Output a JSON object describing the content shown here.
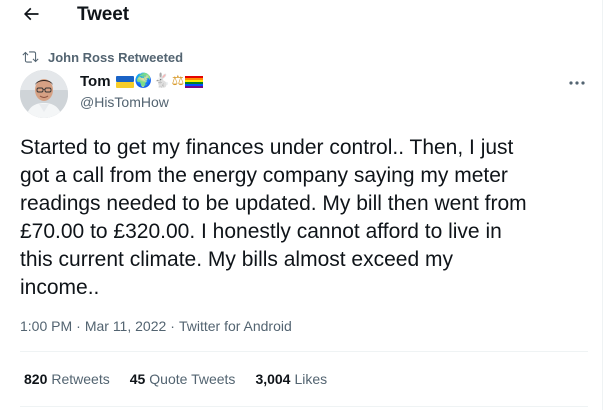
{
  "header": {
    "title": "Tweet",
    "back_icon": "arrow-left-icon"
  },
  "retweet": {
    "icon": "retweet-icon",
    "text": "John Ross Retweeted"
  },
  "author": {
    "display_name": "Tom",
    "handle": "@HisTomHow",
    "badges": [
      "ukraine-flag",
      "earth-globe",
      "rabbit",
      "balance-scale",
      "rainbow-flag"
    ],
    "badge_glyphs": {
      "globe": "🌍",
      "rabbit": "🐇",
      "scale": "⚖"
    }
  },
  "tweet": {
    "text": "Started to get my finances under control.. Then, I just\ngot a call from the energy company saying my meter\nreadings needed to be updated. My bill then went from\n£70.00 to £320.00. I honestly cannot afford to live in\nthis current climate. My bills almost exceed my\nincome..",
    "time": "1:00 PM",
    "date": "Mar 11, 2022",
    "separator": "·",
    "source": "Twitter for Android"
  },
  "stats": {
    "retweets": {
      "value": "820",
      "label": "Retweets"
    },
    "quote_tweets": {
      "value": "45",
      "label": "Quote Tweets"
    },
    "likes": {
      "value": "3,004",
      "label": "Likes"
    }
  },
  "colors": {
    "text_primary": "#0f1419",
    "text_secondary": "#536471",
    "divider": "#eff3f4"
  }
}
